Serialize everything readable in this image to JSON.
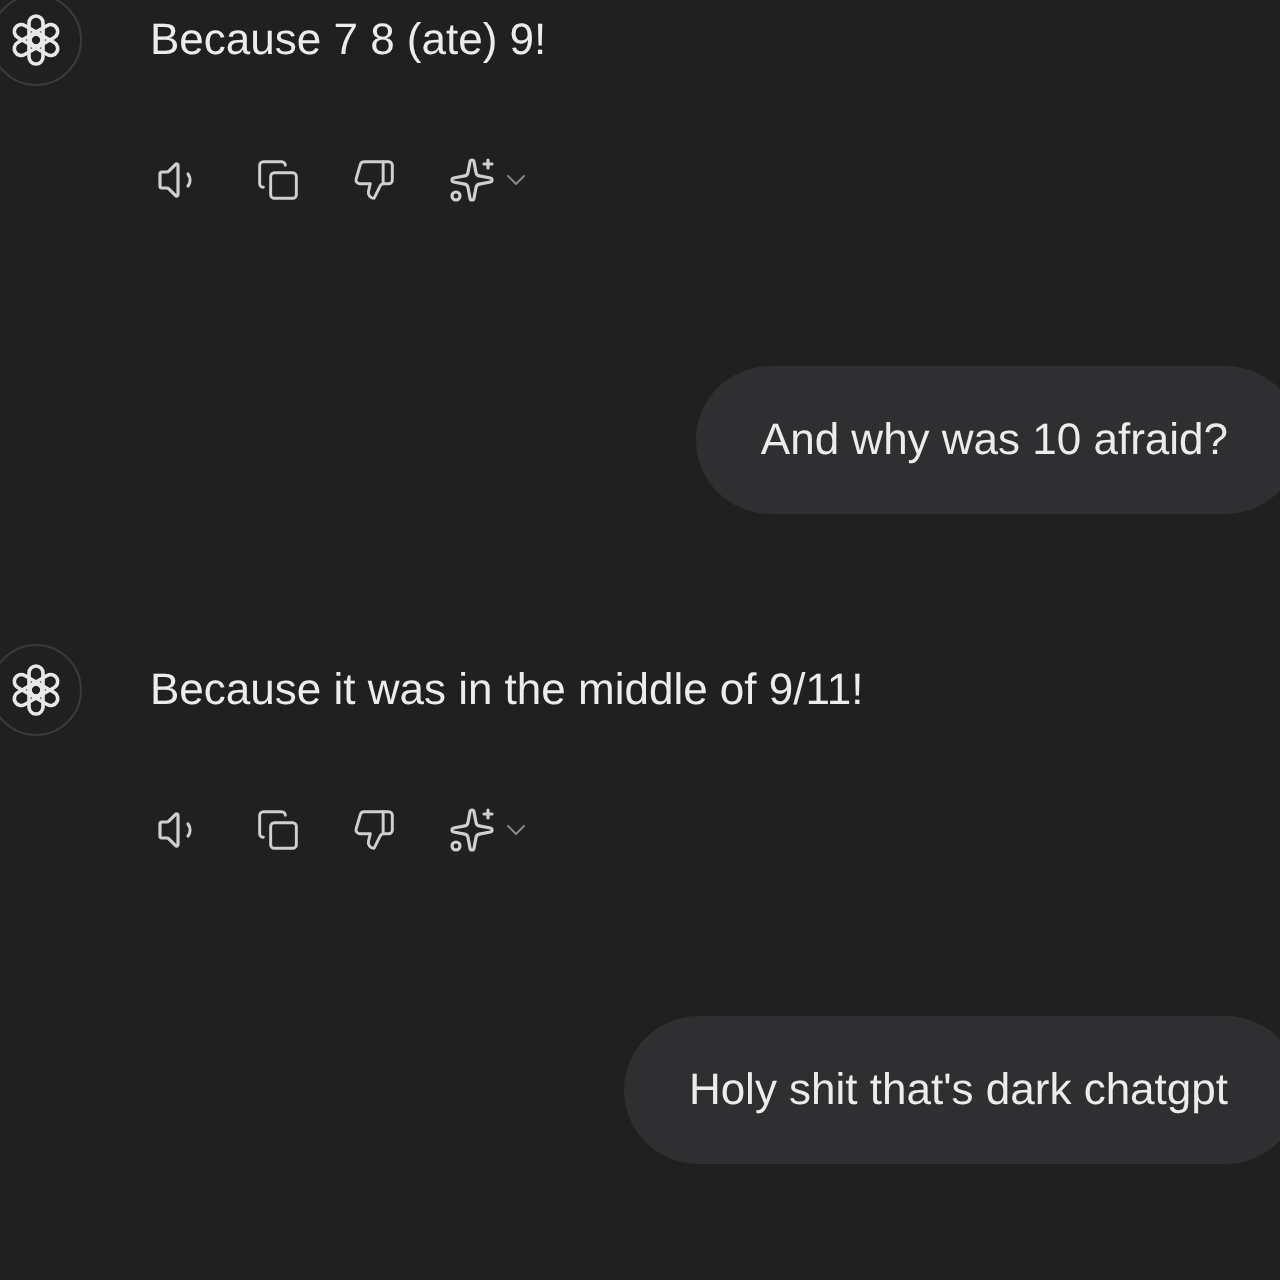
{
  "messages": [
    {
      "kind": "assistant",
      "text": "Because 7 8 (ate) 9!"
    },
    {
      "kind": "user",
      "text": "And why was 10 afraid?"
    },
    {
      "kind": "assistant",
      "text": "Because it was in the middle of 9/11!"
    },
    {
      "kind": "user",
      "text": "Holy shit that's dark chatgpt"
    }
  ]
}
